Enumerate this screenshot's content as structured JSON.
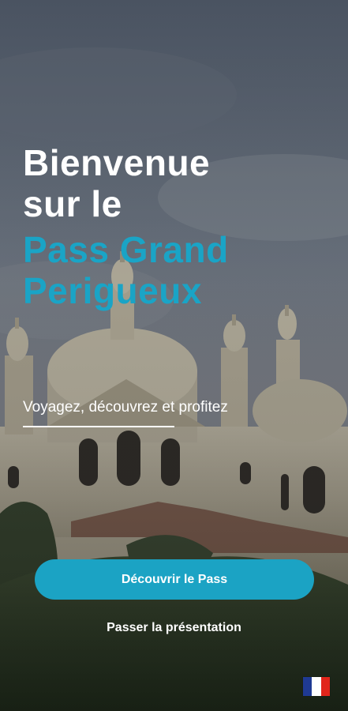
{
  "welcome": {
    "line1": "Bienvenue",
    "line2": "sur le",
    "brand_line1": "Pass Grand",
    "brand_line2": "Perigueux",
    "tagline": "Voyagez, découvrez et profitez"
  },
  "actions": {
    "discover_label": "Découvrir le Pass",
    "skip_label": "Passer la présentation"
  },
  "language": {
    "flag_icon": "france-flag-icon",
    "colors": [
      "#1f3a93",
      "#ffffff",
      "#e1251b"
    ]
  },
  "theme": {
    "accent": "#1aa4c6",
    "button": "#1ba3c4",
    "text": "#ffffff"
  }
}
